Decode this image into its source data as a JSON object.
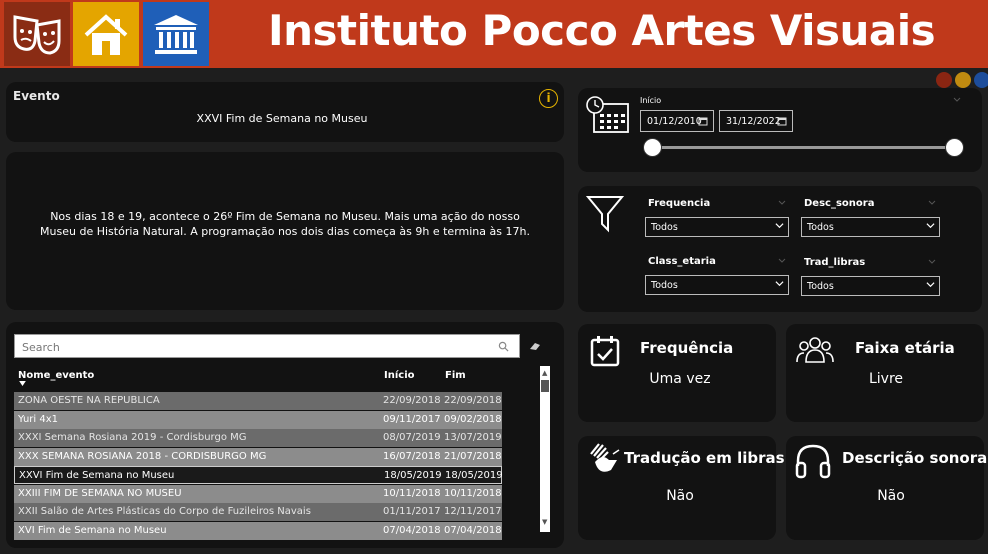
{
  "header": {
    "title": "Instituto Pocco Artes Visuais",
    "nav": [
      {
        "icon": "theater-masks-icon",
        "bg": "#8a2c14"
      },
      {
        "icon": "home-icon",
        "bg": "#e4a500"
      },
      {
        "icon": "museum-icon",
        "bg": "#1f5fb8"
      }
    ],
    "theme_dots": [
      "#8a2512",
      "#c08a10",
      "#1d4d9b"
    ]
  },
  "evento": {
    "label": "Evento",
    "name": "XXVI Fim de Semana no Museu",
    "description": "Nos dias 18 e 19, acontece o 26º Fim de Semana no Museu. Mais uma ação do nosso Museu de História Natural. A programação nos dois dias começa às 9h e termina às 17h."
  },
  "table": {
    "search_placeholder": "Search",
    "columns": [
      "Nome_evento",
      "Início",
      "Fim"
    ],
    "rows": [
      [
        "ZONA OESTE NA REPÚBLICA",
        "22/09/2018",
        "22/09/2018"
      ],
      [
        "Yuri 4x1",
        "09/11/2017",
        "09/02/2018"
      ],
      [
        "XXXI Semana Rosiana 2019 - Cordisburgo MG",
        "08/07/2019",
        "13/07/2019"
      ],
      [
        "XXX SEMANA ROSIANA 2018 - CORDISBURGO MG",
        "16/07/2018",
        "21/07/2018"
      ],
      [
        "XXVI Fim de Semana no Museu",
        "18/05/2019",
        "18/05/2019"
      ],
      [
        "XXIII FIM DE SEMANA NO MUSEU",
        "10/11/2018",
        "10/11/2018"
      ],
      [
        "XXII Salão de Artes Plásticas do Corpo de Fuzileiros Navais",
        "01/11/2017",
        "12/11/2017"
      ],
      [
        "XVI Fim de Semana no Museu",
        "07/04/2018",
        "07/04/2018"
      ]
    ],
    "selected_index": 4
  },
  "date_filter": {
    "label": "Início",
    "start": "01/12/2010",
    "end": "31/12/2022",
    "range_fraction": [
      0.0,
      1.0
    ]
  },
  "filters": [
    {
      "label": "Frequencia",
      "value": "Todos"
    },
    {
      "label": "Desc_sonora",
      "value": "Todos"
    },
    {
      "label": "Class_etaria",
      "value": "Todos"
    },
    {
      "label": "Trad_libras",
      "value": "Todos"
    }
  ],
  "kpis": {
    "frequencia": {
      "title": "Frequência",
      "value": "Uma vez",
      "icon": "calendar-check-icon"
    },
    "faixa": {
      "title": "Faixa etária",
      "value": "Livre",
      "icon": "group-people-icon"
    },
    "libras": {
      "title": "Tradução em libras",
      "value": "Não",
      "icon": "sign-language-hands-icon"
    },
    "sonora": {
      "title": "Descrição sonora",
      "value": "Não",
      "icon": "headphones-icon"
    }
  }
}
